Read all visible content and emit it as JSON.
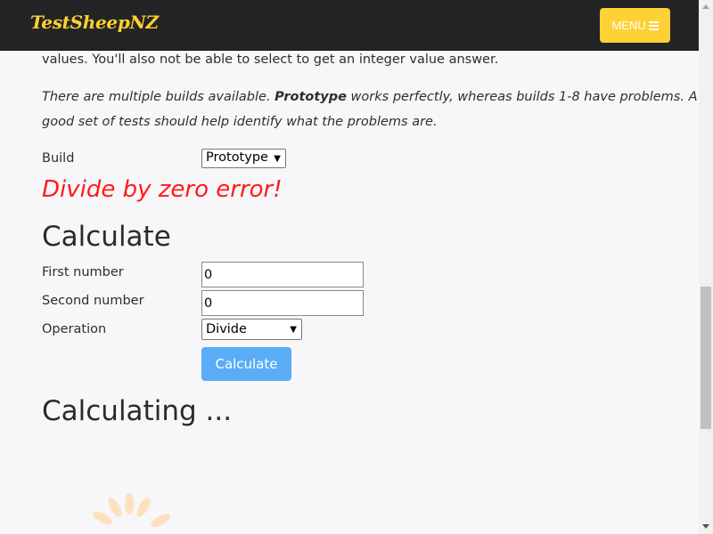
{
  "navbar": {
    "brand": "TestSheepNZ",
    "menu_label": "MENU",
    "menu_icon": "hamburger-icon",
    "brand_color": "#fed136"
  },
  "intro": {
    "line1": "values. You'll also not be able to select to get an integer value answer.",
    "line2_pre": "There are multiple builds available. ",
    "line2_bold": "Prototype",
    "line2_post": " works perfectly, whereas builds 1-8 have problems. A",
    "line3": "good set of tests should help identify what the problems are."
  },
  "build": {
    "label": "Build",
    "selected": "Prototype"
  },
  "error_message": "Divide by zero error!",
  "calculate_section": {
    "heading": "Calculate",
    "first_label": "First number",
    "first_value": "0",
    "second_label": "Second number",
    "second_value": "0",
    "operation_label": "Operation",
    "operation_selected": "Divide",
    "button_label": "Calculate"
  },
  "status_heading": "Calculating ...",
  "colors": {
    "error": "#ff1a1a",
    "button": "#59acf6",
    "spinner": "#fde0bd"
  }
}
